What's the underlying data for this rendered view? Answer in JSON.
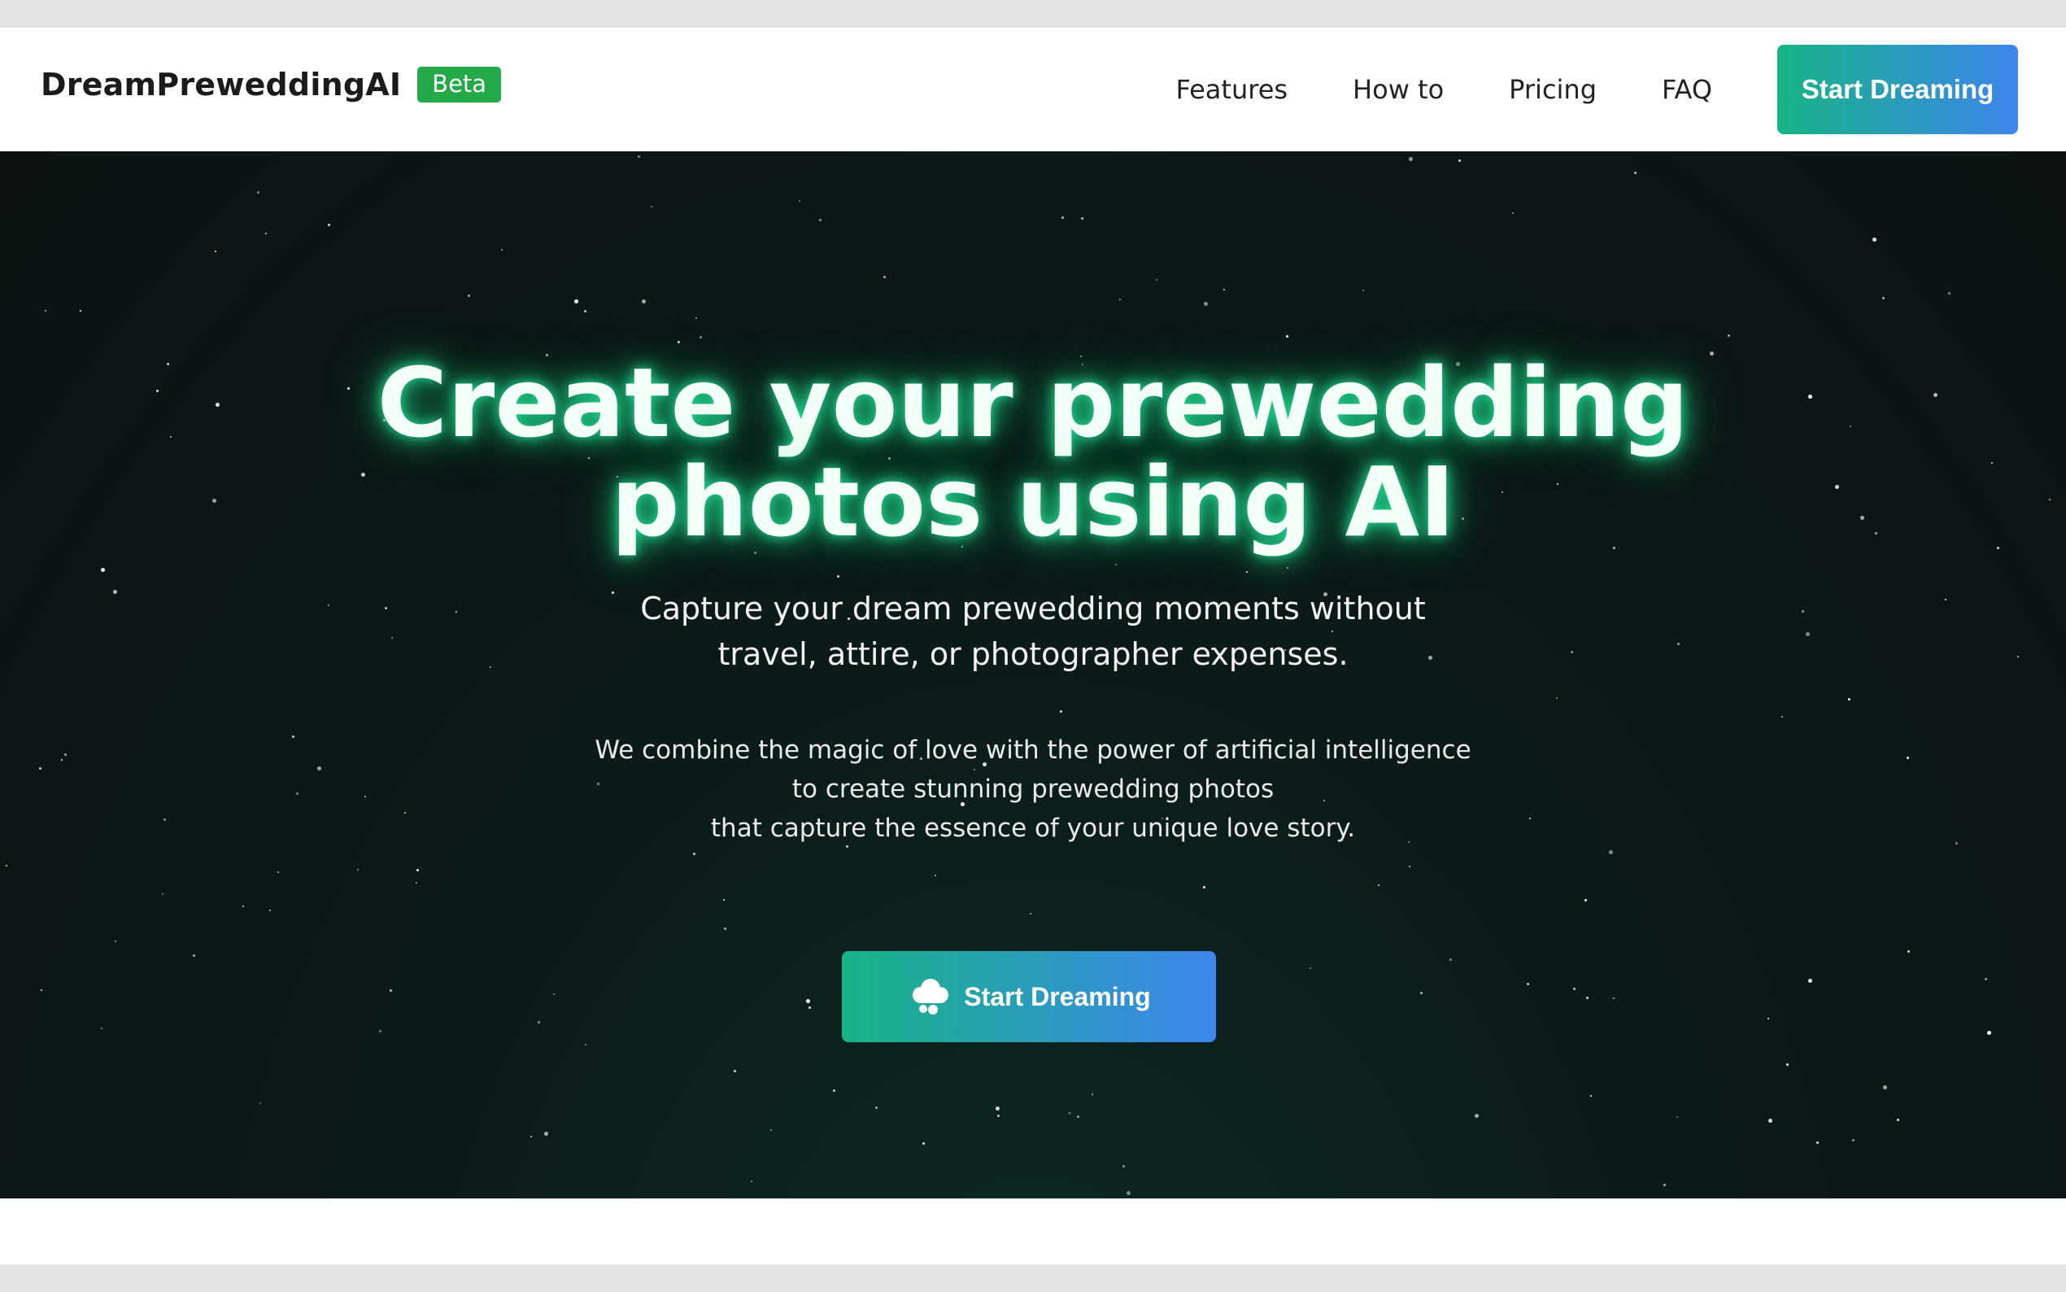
{
  "nav": {
    "brand": "DreamPreweddingAI",
    "badge": "Beta",
    "links": [
      "Features",
      "How to",
      "Pricing",
      "FAQ"
    ],
    "cta": "Start Dreaming"
  },
  "hero": {
    "headline_line1": "Create your prewedding",
    "headline_line2": "photos using AI",
    "subhead_line1": "Capture your dream prewedding moments without",
    "subhead_line2": "travel, attire, or photographer expenses.",
    "desc_line1": "We combine the magic of love with the power of artificial intelligence",
    "desc_line2": "to create stunning prewedding photos",
    "desc_line3": "that capture the essence of your unique love story.",
    "cta": "Start Dreaming",
    "cta_icon": "cloud-icon"
  },
  "colors": {
    "badge": "#23a948",
    "cta_gradient_start": "#17b486",
    "cta_gradient_end": "#3e85ec",
    "hero_bg": "#0e1312",
    "glow": "#23d58e"
  }
}
